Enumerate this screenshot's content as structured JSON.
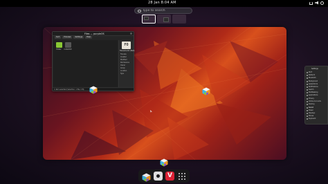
{
  "topbar": {
    "clock": "28 Jan   8:04 AM"
  },
  "search": {
    "placeholder": "Type to search"
  },
  "window": {
    "title": "Files — purpleOS",
    "toolbar": [
      "Sort",
      "Preview",
      "Settings",
      "Help"
    ],
    "files": [
      {
        "name": "Folder",
        "color": "#8ac834"
      },
      {
        "name": "rocket.txt",
        "color": "#555555"
      }
    ],
    "preview_name": "Filename.txt (Text)",
    "properties": [
      "File size",
      "Created",
      "Modified",
      "Permissions",
      "Owner",
      "Group",
      "Location",
      "Type"
    ],
    "status": "1 item selected (Selection: 1 file, 0 B)"
  },
  "side_panel": {
    "title": "Settings",
    "items": [
      "Wi-Fi",
      "Network",
      "Bluetooth",
      "Background",
      "Appearance",
      "Notifications",
      "Search",
      "Multitasking",
      "Applications",
      "Privacy",
      "Online Accounts",
      "Sharing",
      "Sound",
      "Power",
      "Displays",
      "Mouse",
      "Keyboard"
    ],
    "selected_index": 12
  },
  "dash": {
    "apps": [
      "purpleos-cube-icon",
      "settings-icon",
      "vivaldi-icon",
      "app-grid-icon"
    ]
  },
  "colors": {
    "accent": "#ffffff",
    "cube_top": "#f5f5f5",
    "cube_left_a": "#3db4e6",
    "cube_left_b": "#8ac834",
    "cube_right_a": "#f29a1e",
    "cube_right_b": "#8a4fc8"
  }
}
